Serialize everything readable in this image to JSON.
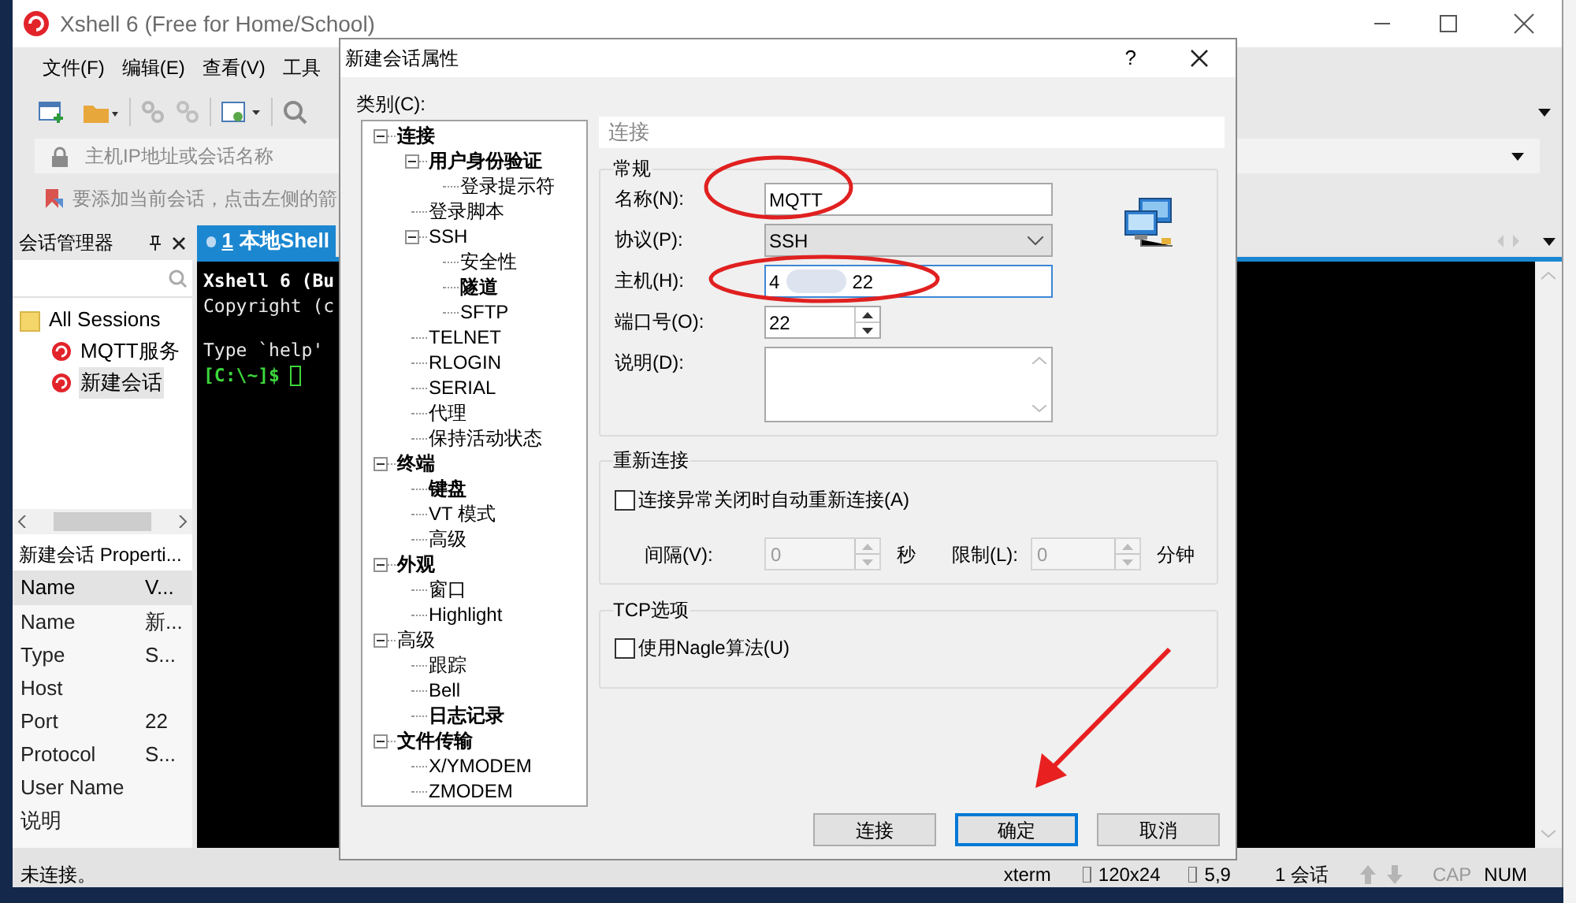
{
  "main_window": {
    "title": "Xshell 6 (Free for Home/School)",
    "menu": [
      "文件(F)",
      "编辑(E)",
      "查看(V)",
      "工具"
    ],
    "address_placeholder": "主机IP地址或会话名称",
    "hint": "要添加当前会话，点击左侧的箭",
    "session_manager": {
      "title": "会话管理器",
      "tree": [
        {
          "label": "All Sessions",
          "kind": "folder",
          "selected": false,
          "children": [
            {
              "label": "MQTT服务",
              "kind": "session",
              "selected": false
            },
            {
              "label": "新建会话",
              "kind": "session",
              "selected": true
            }
          ]
        }
      ],
      "properties_title": "新建会话 Properti...",
      "properties_columns": [
        "Name",
        "V..."
      ],
      "properties_rows": [
        {
          "name": "Name",
          "value": "新..."
        },
        {
          "name": "Type",
          "value": "S..."
        },
        {
          "name": "Host"
        },
        {
          "name": "Port",
          "value": "22"
        },
        {
          "name": "Protocol",
          "value": "S..."
        },
        {
          "name": "User Name"
        },
        {
          "name": "说明"
        }
      ]
    },
    "terminal": {
      "tab": {
        "number": "1",
        "label": "本地Shell",
        "selected": true
      },
      "lines": [
        {
          "kind": "heading",
          "text": "Xshell 6 (Bu"
        },
        {
          "kind": "plain",
          "text": "Copyright (c"
        },
        {
          "kind": "plain",
          "text": "Type `help' ",
          "gap_before": true
        },
        {
          "kind": "prompt",
          "text": "[C:\\~]$ "
        }
      ]
    },
    "status_bar": {
      "text": "未连接。",
      "terminal_type": "xterm",
      "size": "120x24",
      "cursor": "5,9",
      "sessions": "1 会话",
      "caps": {
        "label": "CAP",
        "on": false
      },
      "num": {
        "label": "NUM",
        "on": true
      }
    }
  },
  "dialog": {
    "title": "新建会话属性",
    "help": "?",
    "category_label": "类别(C):",
    "tree": [
      {
        "label": "连接",
        "bold": true,
        "expanded": true,
        "children": [
          {
            "label": "用户身份验证",
            "bold": true,
            "expanded": true,
            "children": [
              {
                "label": "登录提示符",
                "bold": false
              }
            ]
          },
          {
            "label": "登录脚本",
            "bold": false
          },
          {
            "label": "SSH",
            "bold": false,
            "expanded": true,
            "children": [
              {
                "label": "安全性",
                "bold": false
              },
              {
                "label": "隧道",
                "bold": true
              },
              {
                "label": "SFTP",
                "bold": false
              }
            ]
          },
          {
            "label": "TELNET",
            "bold": false
          },
          {
            "label": "RLOGIN",
            "bold": false
          },
          {
            "label": "SERIAL",
            "bold": false
          },
          {
            "label": "代理",
            "bold": false
          },
          {
            "label": "保持活动状态",
            "bold": false
          }
        ]
      },
      {
        "label": "终端",
        "bold": true,
        "expanded": true,
        "children": [
          {
            "label": "键盘",
            "bold": true
          },
          {
            "label": "VT 模式",
            "bold": false
          },
          {
            "label": "高级",
            "bold": false
          }
        ]
      },
      {
        "label": "外观",
        "bold": true,
        "expanded": true,
        "children": [
          {
            "label": "窗口",
            "bold": false
          },
          {
            "label": "Highlight",
            "bold": false
          }
        ]
      },
      {
        "label": "高级",
        "bold": false,
        "expanded": true,
        "children": [
          {
            "label": "跟踪",
            "bold": false
          },
          {
            "label": "Bell",
            "bold": false
          },
          {
            "label": "日志记录",
            "bold": true
          }
        ]
      },
      {
        "label": "文件传输",
        "bold": true,
        "expanded": true,
        "children": [
          {
            "label": "X/YMODEM",
            "bold": false
          },
          {
            "label": "ZMODEM",
            "bold": false
          }
        ]
      }
    ],
    "section_title": "连接",
    "general": {
      "title": "常规",
      "fields": [
        {
          "label": "名称(N):",
          "kind": "text",
          "value": "MQTT",
          "focused": false
        },
        {
          "label": "协议(P):",
          "kind": "select",
          "value": "SSH",
          "focused": false
        },
        {
          "label": "主机(H):",
          "kind": "host",
          "value": "4",
          "value_end": "22",
          "focused": true
        },
        {
          "label": "端口号(O):",
          "kind": "spin",
          "value": "22",
          "focused": false
        },
        {
          "label": "说明(D):",
          "kind": "textarea",
          "focused": false
        }
      ]
    },
    "reconnect": {
      "title": "重新连接",
      "checkbox": {
        "label": "连接异常关闭时自动重新连接(A)",
        "checked": false
      },
      "interval": {
        "label": "间隔(V):",
        "value": "0",
        "unit": "秒",
        "disabled": true
      },
      "limit": {
        "label": "限制(L):",
        "value": "0",
        "unit": "分钟",
        "disabled": true
      }
    },
    "tcp": {
      "title": "TCP选项",
      "checkbox": {
        "label": "使用Nagle算法(U)",
        "checked": false
      }
    },
    "buttons": [
      {
        "label": "连接",
        "default": false
      },
      {
        "label": "确定",
        "default": true
      },
      {
        "label": "取消",
        "default": false
      }
    ]
  }
}
